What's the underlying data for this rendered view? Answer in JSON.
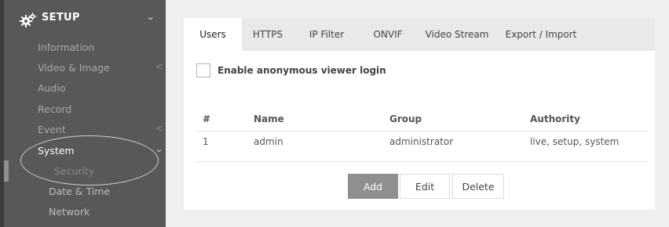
{
  "sidebar": {
    "header": {
      "label": "SETUP",
      "icon": "gears-icon"
    },
    "items": [
      {
        "label": "Information"
      },
      {
        "label": "Video & Image",
        "chevron": "<"
      },
      {
        "label": "Audio"
      },
      {
        "label": "Record"
      },
      {
        "label": "Event",
        "chevron": "<"
      },
      {
        "label": "System",
        "chevron": "⌄"
      },
      {
        "label": "Security"
      },
      {
        "label": "Date & Time"
      },
      {
        "label": "Network"
      }
    ]
  },
  "tabs": [
    {
      "label": "Users"
    },
    {
      "label": "HTTPS"
    },
    {
      "label": "IP Filter"
    },
    {
      "label": "ONVIF"
    },
    {
      "label": "Video Stream"
    },
    {
      "label": "Export / Import"
    }
  ],
  "active_tab": "Users",
  "anonymous_login": {
    "label": "Enable anonymous viewer login",
    "checked": false
  },
  "users_table": {
    "headers": [
      "#",
      "Name",
      "Group",
      "Authority"
    ],
    "rows": [
      [
        "1",
        "admin",
        "administrator",
        "live, setup, system"
      ]
    ]
  },
  "buttons": {
    "add": "Add",
    "edit": "Edit",
    "delete": "Delete"
  },
  "colors": {
    "sidebar_bg": "#585858",
    "panel_bg": "#e9e9e9",
    "primary_button": "#8f8f8f"
  }
}
